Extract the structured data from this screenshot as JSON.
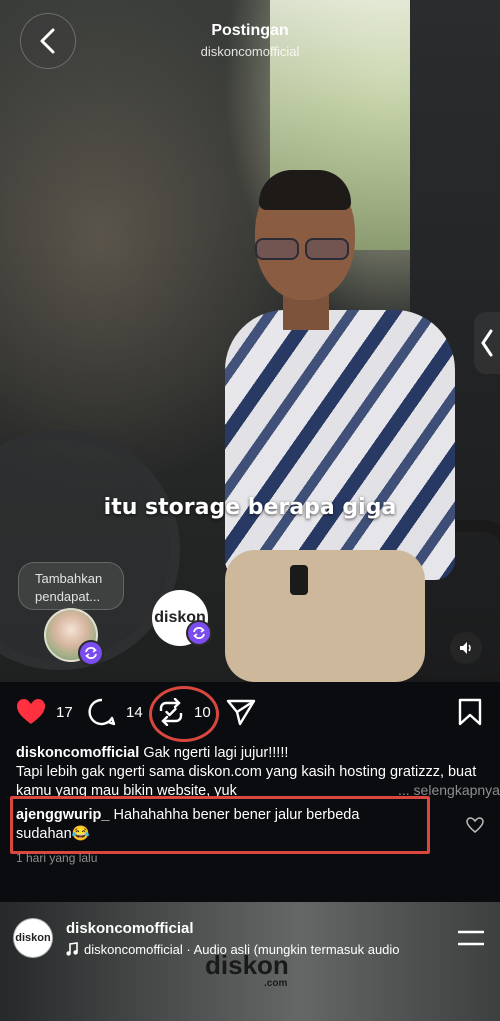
{
  "header": {
    "title": "Postingan",
    "subtitle": "diskoncomofficial"
  },
  "video": {
    "caption": "itu storage berapa giga",
    "note_placeholder": "Tambahkan pendapat...",
    "creator_avatar_text": "diskon"
  },
  "actions": {
    "likes": "17",
    "comments": "14",
    "reposts": "10",
    "liked": true
  },
  "post": {
    "username": "diskoncomofficial",
    "caption_line1": "Gak ngerti lagi jujur!!!!!",
    "caption_line2": "Tapi lebih gak ngerti sama diskon.com yang kasih hosting gratizzz, buat kamu yang mau bikin website, yuk",
    "more_label": "... selengkapnya"
  },
  "comment": {
    "username": "ajenggwurip_",
    "text": "Hahahahha bener bener jalur berbeda sudahan😂",
    "time": "1 hari yang lalu"
  },
  "next_post": {
    "avatar_text": "diskon",
    "username": "diskoncomofficial",
    "audio": "diskoncomofficial · Audio asli  (mungkin termasuk audio",
    "logo_text": "diskon",
    "logo_sub": ".com"
  },
  "colors": {
    "like_red": "#ff3040",
    "highlight_red": "#d9473f",
    "repost_purple": "#7b4cf0",
    "muted_text": "#8e8e8e"
  },
  "icons": {
    "back": "chevron-left-icon",
    "like": "heart-icon",
    "comment": "comment-bubble-icon",
    "repost": "repost-icon",
    "share": "send-icon",
    "save": "bookmark-icon",
    "mute": "speaker-icon",
    "audio": "music-note-icon",
    "menu": "menu-icon"
  }
}
